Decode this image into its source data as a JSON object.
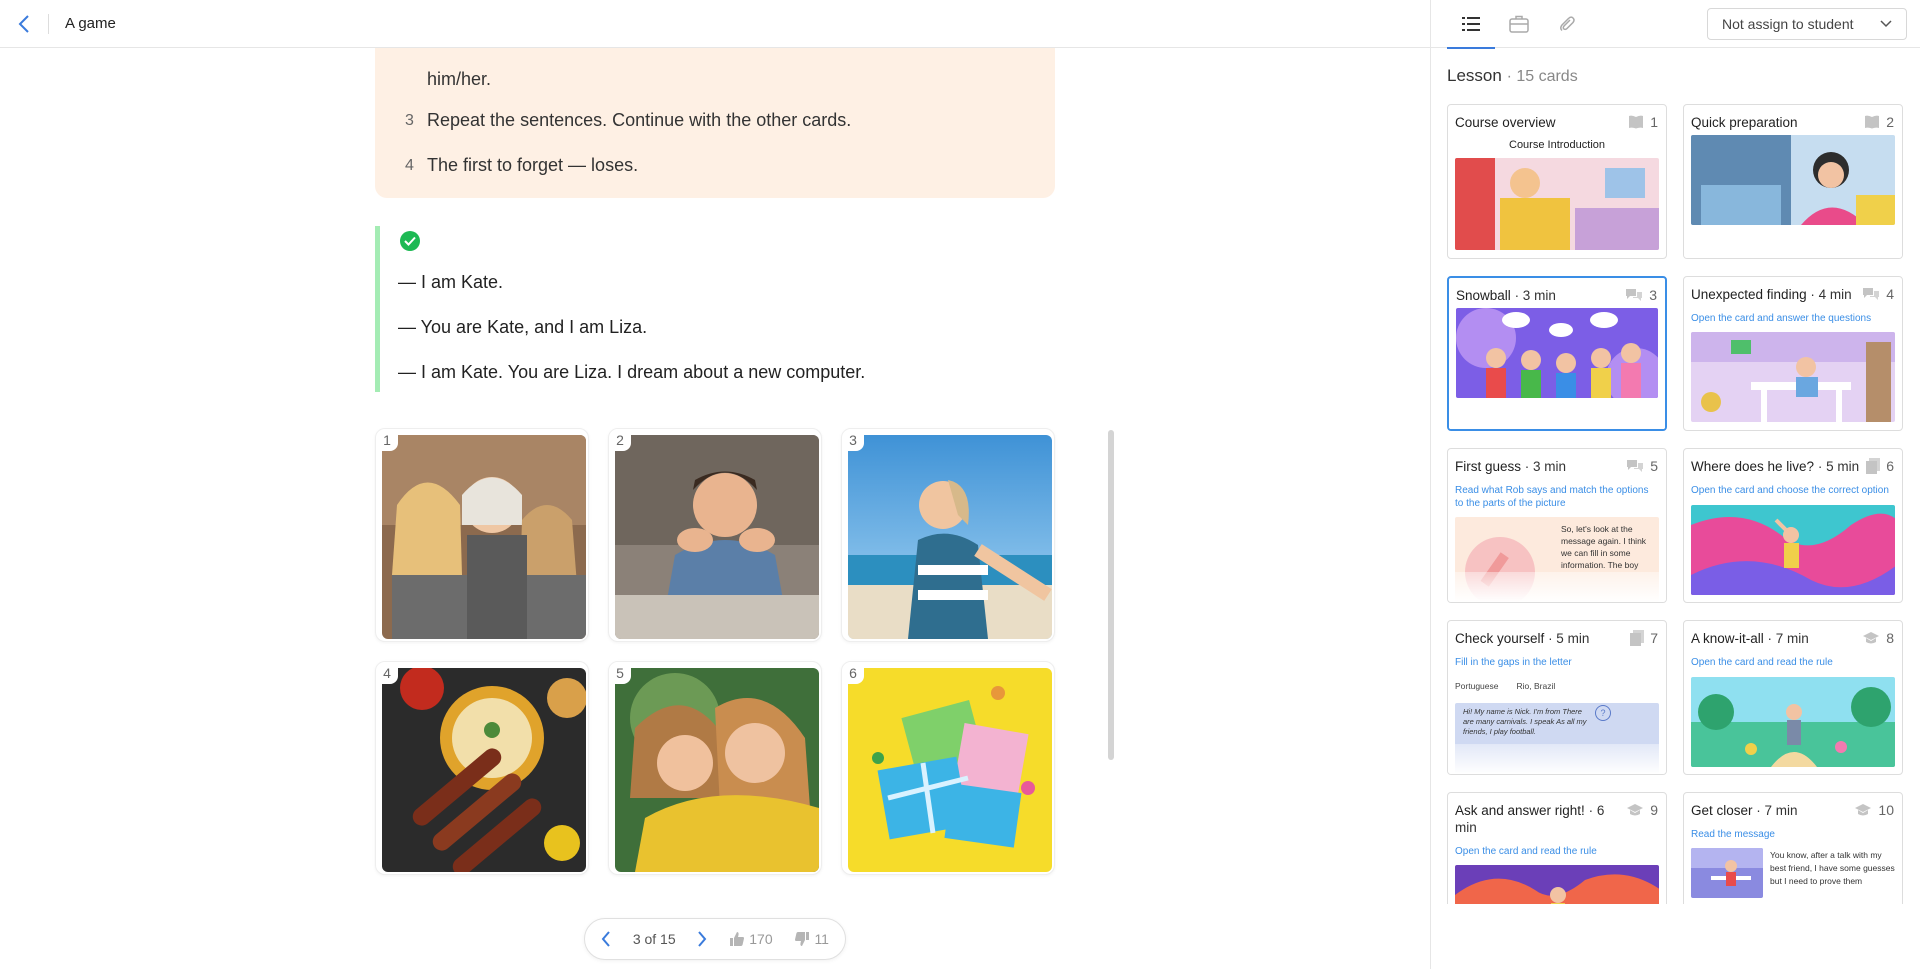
{
  "header": {
    "title": "A game"
  },
  "instructions": [
    {
      "num": "",
      "text": "him/her."
    },
    {
      "num": "3",
      "text": "Repeat the sentences. Continue with the other cards."
    },
    {
      "num": "4",
      "text": "The first to forget — loses."
    }
  ],
  "answer": {
    "lines": [
      "— I am Kate.",
      "— You are Kate, and I am Liza.",
      "— I am Kate. You are Liza. I dream about a new computer."
    ]
  },
  "grid": [
    {
      "num": "1",
      "icon": "family-photo"
    },
    {
      "num": "2",
      "icon": "dreaming-boy-photo"
    },
    {
      "num": "3",
      "icon": "beach-girl-photo"
    },
    {
      "num": "4",
      "icon": "food-photo"
    },
    {
      "num": "5",
      "icon": "friends-hug-photo"
    },
    {
      "num": "6",
      "icon": "gifts-photo"
    }
  ],
  "pager": {
    "position": "3 of 15",
    "likes": "170",
    "dislikes": "11"
  },
  "sidebar": {
    "assign_label": "Not assign to student",
    "lesson_label": "Lesson",
    "lesson_count": "· 15 cards",
    "cards": [
      {
        "title": "Course overview",
        "duration": "",
        "num": "1",
        "kind": "book-icon",
        "subtitle": "Course Introduction",
        "accent": "#f08a7e"
      },
      {
        "title": "Quick preparation",
        "duration": "",
        "num": "2",
        "kind": "book-icon",
        "subtitle": "",
        "accent": "#6ba9e0"
      },
      {
        "title": "Snowball",
        "duration": "· 3 min",
        "num": "3",
        "kind": "chat-icon",
        "subtitle": "",
        "accent": "#8a6de9"
      },
      {
        "title": "Unexpected finding",
        "duration": "· 4 min",
        "num": "4",
        "kind": "chat-icon",
        "subtitle": "Open the card and answer the questions",
        "accent": "#d9c2f0"
      },
      {
        "title": "First guess",
        "duration": "· 3 min",
        "num": "5",
        "kind": "chat-icon",
        "subtitle": "Read what Rob says and match the options to the parts of the picture",
        "accent": "#fde7d8"
      },
      {
        "title": "Where does he live?",
        "duration": "· 5 min",
        "num": "6",
        "kind": "doc-icon",
        "subtitle": "Open the card and choose the correct option",
        "accent": "#3ec6cf"
      },
      {
        "title": "Check yourself",
        "duration": "· 5 min",
        "num": "7",
        "kind": "doc-icon",
        "subtitle": "Fill in the gaps in the letter",
        "accent": "#c9d6f3"
      },
      {
        "title": "A know-it-all",
        "duration": "· 7 min",
        "num": "8",
        "kind": "cap-icon",
        "subtitle": "Open the card and read the rule",
        "accent": "#49c49a"
      },
      {
        "title": "Ask and answer right!",
        "duration": "· 6 min",
        "num": "9",
        "kind": "cap-icon",
        "subtitle": "Open the card and read the rule",
        "accent": "#f0664a"
      },
      {
        "title": "Get closer",
        "duration": "· 7 min",
        "num": "10",
        "kind": "cap-icon",
        "subtitle": "Read the message",
        "accent": "#8a8ae0"
      }
    ],
    "card_texts": {
      "c5": "So, let's look at the message again. I think we can fill in some information. The boy",
      "c7_tags": [
        "Portuguese",
        "Rio, Brazil"
      ],
      "c7": "Hi! My name is Nick. I'm from There are many carnivals. I speak As all my friends, I play football.",
      "c10": "You know, after a talk with my best friend, I have some guesses but I need to prove them"
    }
  },
  "colors": {
    "accent": "#3a8ee6",
    "check": "#1db954",
    "instr_bg": "#fef0e4"
  }
}
